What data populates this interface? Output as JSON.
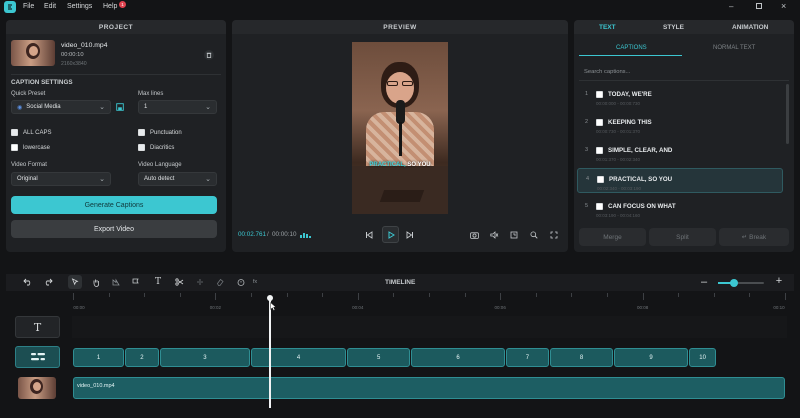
{
  "menu": {
    "file": "File",
    "edit": "Edit",
    "settings": "Settings",
    "help": "Help",
    "help_badge": "1"
  },
  "project": {
    "header": "PROJECT",
    "file_name": "video_010.mp4",
    "duration": "00:00:10",
    "resolution": "2160x3840"
  },
  "caption_settings": {
    "header": "CAPTION SETTINGS",
    "quick_preset_label": "Quick Preset",
    "quick_preset_value": "Social Media",
    "max_lines_label": "Max lines",
    "max_lines_value": "1",
    "all_caps": "ALL CAPS",
    "lowercase": "lowercase",
    "punctuation": "Punctuation",
    "diacritics": "Diacritics",
    "video_format_label": "Video Format",
    "video_format_value": "Original",
    "video_language_label": "Video Language",
    "video_language_value": "Auto detect",
    "generate_button": "Generate Captions",
    "export_button": "Export Video"
  },
  "preview": {
    "header": "PREVIEW",
    "caption_highlight": "PRACTICAL,",
    "caption_rest": "SO YOU",
    "current_time": "00:02.761",
    "separator": "/",
    "total_time": "00:00:10"
  },
  "right_panel": {
    "tabs": [
      "TEXT",
      "STYLE",
      "ANIMATION"
    ],
    "subtabs": [
      "CAPTIONS",
      "NORMAL TEXT"
    ],
    "search_placeholder": "Search captions...",
    "merge": "Merge",
    "split": "Split",
    "break": "↵ Break",
    "captions": [
      {
        "num": "1",
        "text": "TODAY, WE'RE",
        "time": "00:00:000 - 00:00:730"
      },
      {
        "num": "2",
        "text": "KEEPING THIS",
        "time": "00:00:730 - 00:01:370"
      },
      {
        "num": "3",
        "text": "SIMPLE, CLEAR, AND",
        "time": "00:01:370 - 00:02:340"
      },
      {
        "num": "4",
        "text": "PRACTICAL, SO YOU",
        "time": "00:02:340 - 00:03:190"
      },
      {
        "num": "5",
        "text": "CAN FOCUS ON WHAT",
        "time": "00:03:190 - 00:04:160"
      }
    ]
  },
  "timeline": {
    "header": "TIMELINE",
    "ruler": [
      "00:00",
      "00:02",
      "00:04",
      "00:06",
      "00:08",
      "00:10"
    ],
    "video_clip": "video_010.mp4",
    "zoom_fraction": 0.35,
    "playhead_seconds": 2.761,
    "total_seconds": 10,
    "clips": [
      {
        "label": "1",
        "start": 0.0,
        "end": 0.73
      },
      {
        "label": "2",
        "start": 0.73,
        "end": 1.22
      },
      {
        "label": "3",
        "start": 1.22,
        "end": 2.5
      },
      {
        "label": "4",
        "start": 2.5,
        "end": 3.85
      },
      {
        "label": "5",
        "start": 3.85,
        "end": 4.75
      },
      {
        "label": "6",
        "start": 4.75,
        "end": 6.08
      },
      {
        "label": "7",
        "start": 6.08,
        "end": 6.7
      },
      {
        "label": "8",
        "start": 6.7,
        "end": 7.6
      },
      {
        "label": "9",
        "start": 7.6,
        "end": 8.65
      },
      {
        "label": "10",
        "start": 8.65,
        "end": 9.05
      }
    ]
  },
  "colors": {
    "accent": "#3cc7d1",
    "clip": "#1c5a5e",
    "badge": "#e0424f"
  }
}
